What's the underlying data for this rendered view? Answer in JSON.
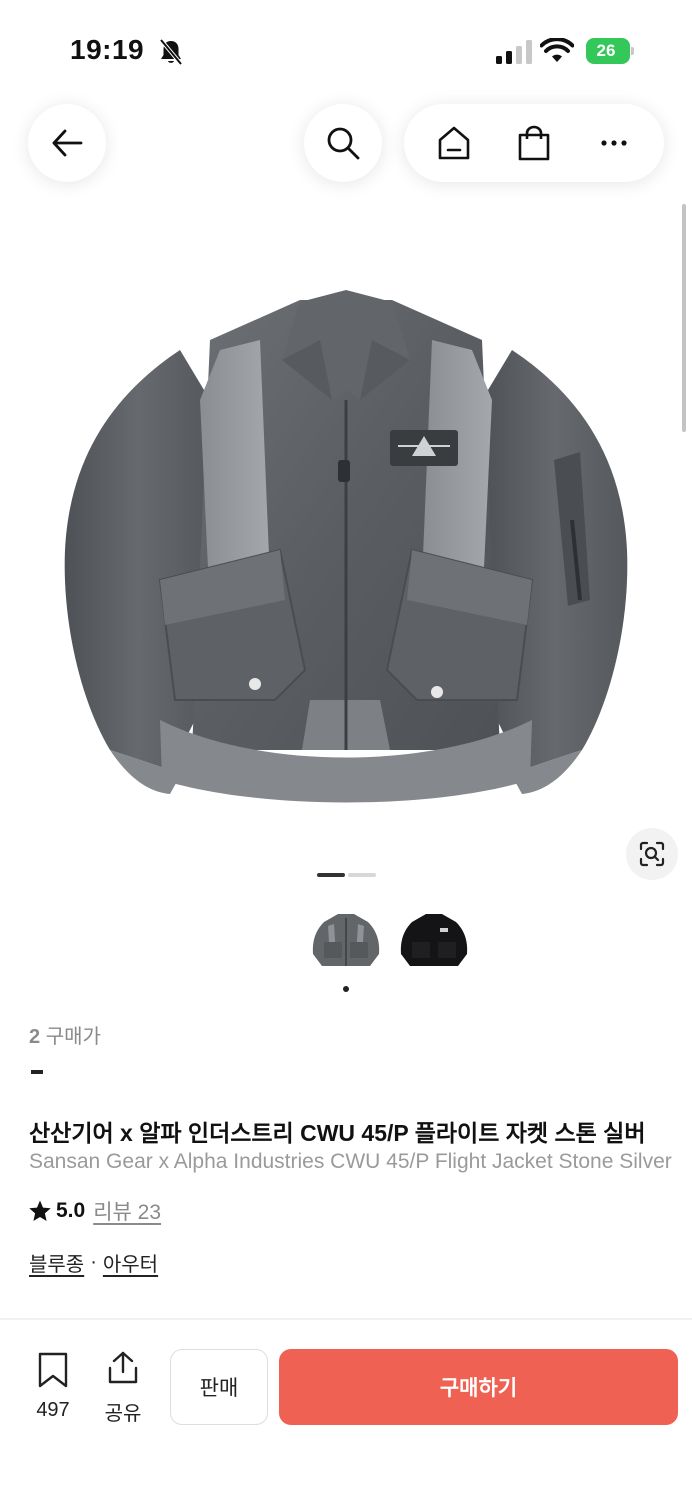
{
  "status_bar": {
    "time": "19:19",
    "battery": "26"
  },
  "nav": {
    "icons": [
      "back-arrow-icon",
      "search-icon",
      "home-icon",
      "shopping-bag-icon",
      "more-icon"
    ]
  },
  "gallery": {
    "page_count": 2,
    "current_page": 1
  },
  "product": {
    "buyer_count_num": "2",
    "buyer_count_label": "구매가",
    "price": "-",
    "title_ko": "산산기어 x 알파 인더스트리 CWU 45/P 플라이트 자켓 스톤 실버",
    "title_en": "Sansan Gear x Alpha Industries CWU 45/P Flight Jacket Stone Silver",
    "rating": "5.0",
    "review_label": "리뷰 23",
    "category_1": "블루종",
    "category_sep": "·",
    "category_2": "아우터"
  },
  "bottom_bar": {
    "bookmark_count": "497",
    "share_label": "공유",
    "sell_label": "판매",
    "buy_label": "구매하기"
  },
  "colors": {
    "buy_button": "#ef6253",
    "battery": "#34c759"
  }
}
